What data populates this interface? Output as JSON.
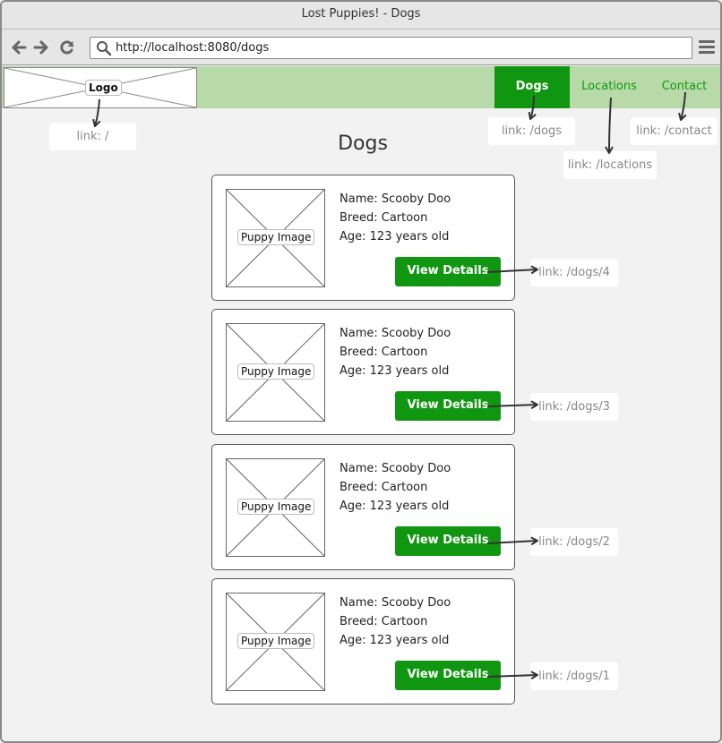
{
  "window": {
    "title": "Lost Puppies! - Dogs"
  },
  "browser": {
    "url": "http://localhost:8080/dogs",
    "icons": [
      "back-arrow-icon",
      "forward-arrow-icon",
      "reload-icon",
      "search-icon",
      "hamburger-menu-icon"
    ]
  },
  "header": {
    "logo_label": "Logo",
    "nav": [
      {
        "label": "Dogs",
        "active": true
      },
      {
        "label": "Locations",
        "active": false
      },
      {
        "label": "Contact",
        "active": false
      }
    ]
  },
  "annotations": {
    "logo": "link: /",
    "dogs": "link: /dogs",
    "locations": "link: /locations",
    "contact": "link: /contact"
  },
  "page": {
    "title": "Dogs"
  },
  "dogs": [
    {
      "image_label": "Puppy Image",
      "name": "Name: Scooby Doo",
      "breed": "Breed: Cartoon",
      "age": "Age: 123 years old",
      "button": "View Details",
      "link_note": "link: /dogs/4"
    },
    {
      "image_label": "Puppy Image",
      "name": "Name: Scooby Doo",
      "breed": "Breed: Cartoon",
      "age": "Age: 123 years old",
      "button": "View Details",
      "link_note": "link: /dogs/3"
    },
    {
      "image_label": "Puppy Image",
      "name": "Name: Scooby Doo",
      "breed": "Breed: Cartoon",
      "age": "Age: 123 years old",
      "button": "View Details",
      "link_note": "link: /dogs/2"
    },
    {
      "image_label": "Puppy Image",
      "name": "Name: Scooby Doo",
      "breed": "Breed: Cartoon",
      "age": "Age: 123 years old",
      "button": "View Details",
      "link_note": "link: /dogs/1"
    }
  ],
  "colors": {
    "accent": "#119611",
    "header_bg": "#b8d9a8",
    "nav_text": "#109b10"
  }
}
